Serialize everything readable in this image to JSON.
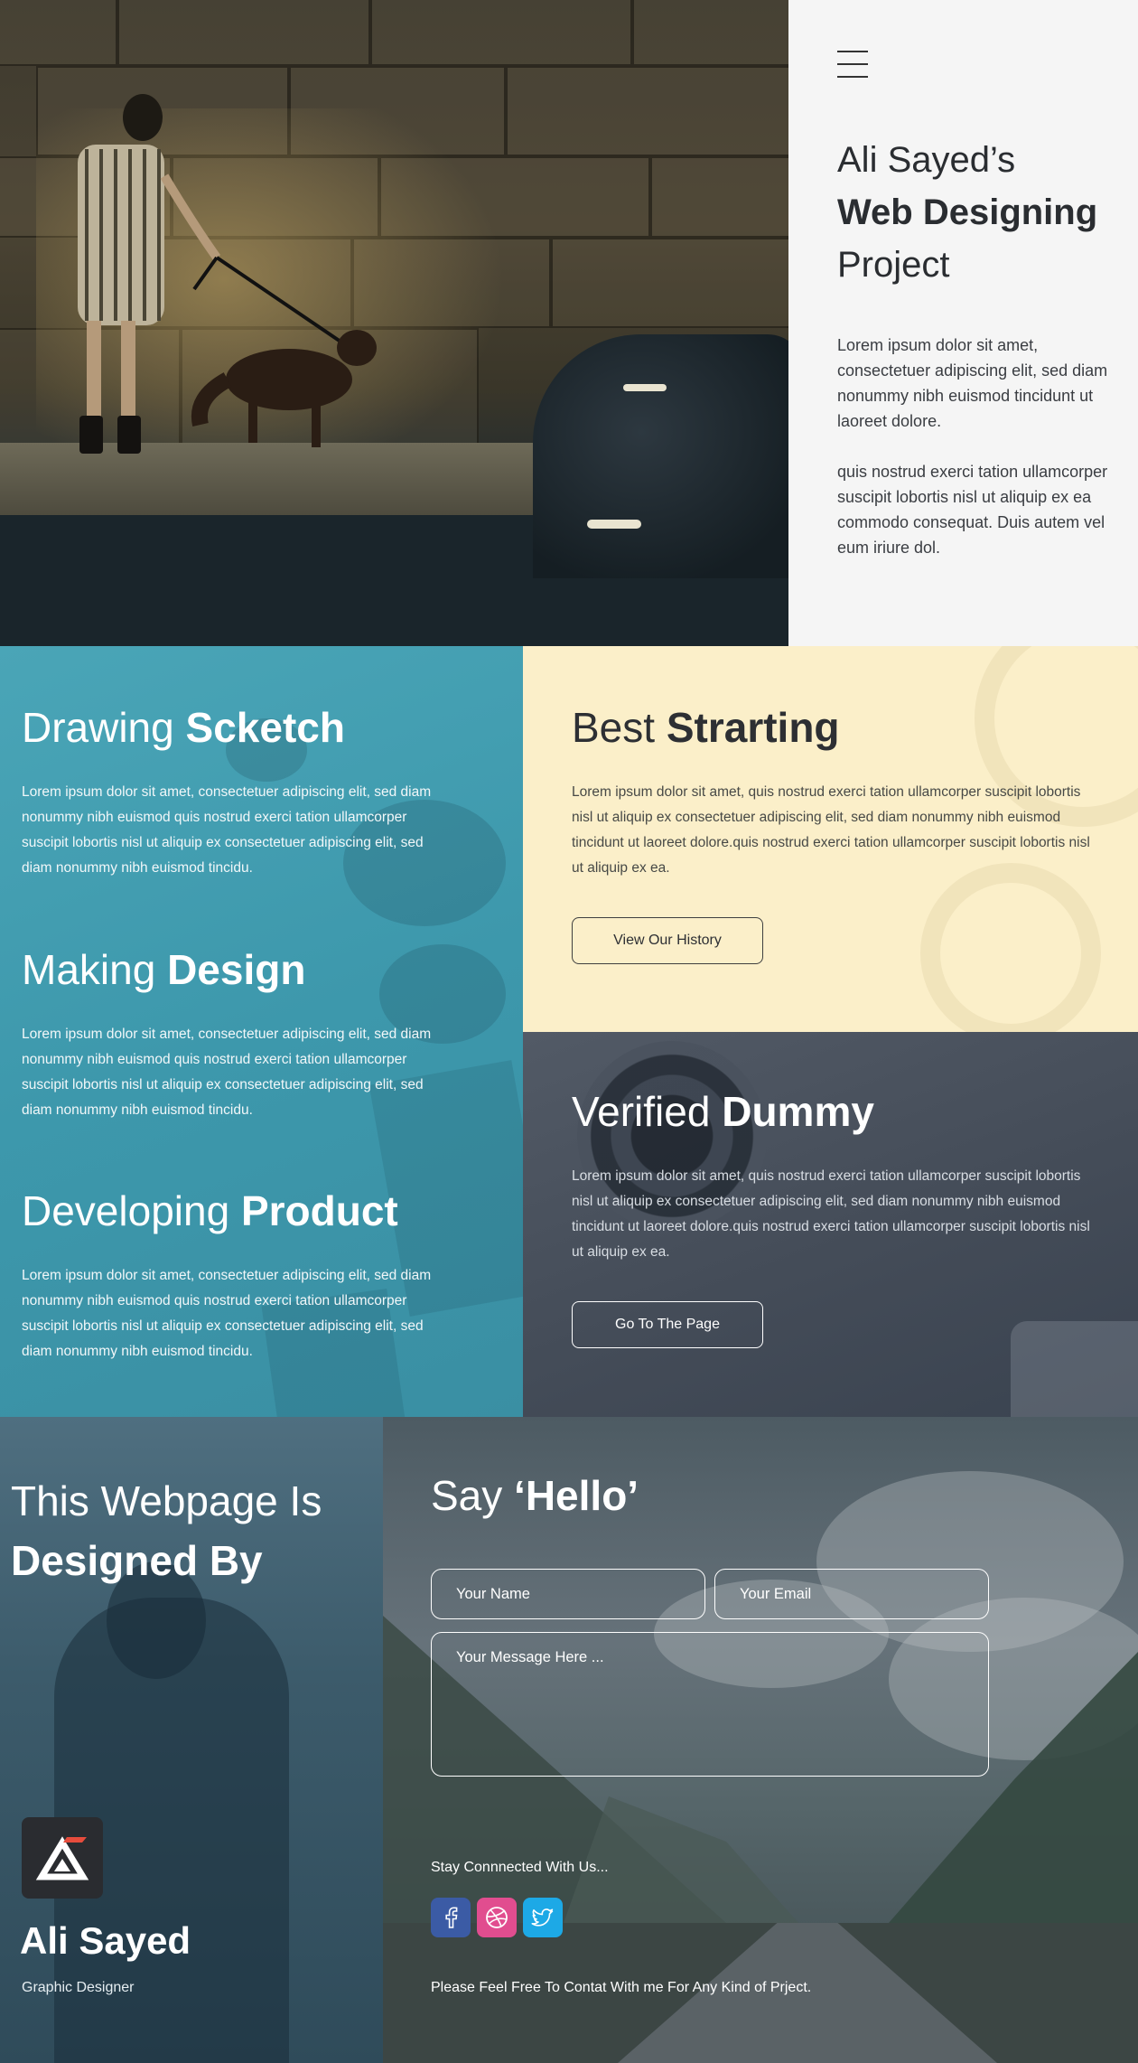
{
  "hero": {
    "title_line1": "Ali Sayed’s",
    "title_line2": "Web Designing",
    "title_line3": "Project",
    "paragraph1": "Lorem ipsum dolor sit amet, consectetuer adipiscing elit, sed diam nonummy nibh euismod tincidunt ut laoreet dolore.",
    "paragraph2": "quis nostrud exerci tation ullamcorper suscipit lobortis nisl ut aliquip ex ea commodo consequat. Duis autem vel eum iriure dol."
  },
  "features": [
    {
      "light": "Drawing",
      "bold": "Scketch",
      "text": "Lorem ipsum dolor sit amet, consectetuer adipiscing elit, sed diam nonummy nibh euismod quis nostrud exerci tation ullamcorper suscipit lobortis nisl ut aliquip ex consectetuer adipiscing elit, sed diam nonummy nibh euismod tincidu."
    },
    {
      "light": "Making",
      "bold": "Design",
      "text": "Lorem ipsum dolor sit amet, consectetuer adipiscing elit, sed diam nonummy nibh euismod quis nostrud exerci tation ullamcorper suscipit lobortis nisl ut aliquip ex consectetuer adipiscing elit, sed diam nonummy nibh euismod tincidu."
    },
    {
      "light": "Developing",
      "bold": "Product",
      "text": "Lorem ipsum dolor sit amet, consectetuer adipiscing elit, sed diam nonummy nibh euismod quis nostrud exerci tation ullamcorper suscipit lobortis nisl ut aliquip ex consectetuer adipiscing elit, sed diam nonummy nibh euismod tincidu."
    }
  ],
  "best": {
    "light": "Best",
    "bold": "Strarting",
    "text": "Lorem ipsum dolor sit amet, quis nostrud exerci tation ullamcorper suscipit lobortis nisl ut aliquip ex  consectetuer adipiscing elit, sed diam nonummy nibh euismod tincidunt ut laoreet dolore.quis nostrud exerci tation ullamcorper suscipit lobortis nisl ut aliquip ex ea.",
    "button": "View Our History"
  },
  "verified": {
    "light": "Verified",
    "bold": "Dummy",
    "text": "Lorem ipsum dolor sit amet, quis nostrud exerci tation ullamcorper suscipit lobortis nisl ut aliquip ex  consectetuer adipiscing elit, sed diam nonummy nibh euismod tincidunt ut laoreet dolore.quis nostrud exerci tation ullamcorper suscipit lobortis nisl ut aliquip ex ea.",
    "button": "Go To The Page"
  },
  "designer": {
    "line1": "This Webpage Is",
    "line2": "Designed By",
    "name": "Ali Sayed",
    "role": "Graphic Designer"
  },
  "contact": {
    "title_light": "Say",
    "title_bold": "‘Hello’",
    "name_placeholder": "Your Name",
    "email_placeholder": "Your Email",
    "message_placeholder": "Your Message Here ...",
    "stay_text": "Stay Connnected With Us...",
    "feel_text": "Please Feel Free To Contat With me For Any Kind of Prject.",
    "social": [
      {
        "icon": "facebook-icon",
        "color": "#3b5ba5"
      },
      {
        "icon": "dribbble-icon",
        "color": "#e14d8f"
      },
      {
        "icon": "twitter-icon",
        "color": "#1da9e6"
      }
    ]
  },
  "colors": {
    "hero_bg": "#f5f5f5",
    "teal": "#4aa5b7",
    "cream": "#fbefc9",
    "slate": "#4a525e",
    "logo_red": "#e74c3c"
  }
}
